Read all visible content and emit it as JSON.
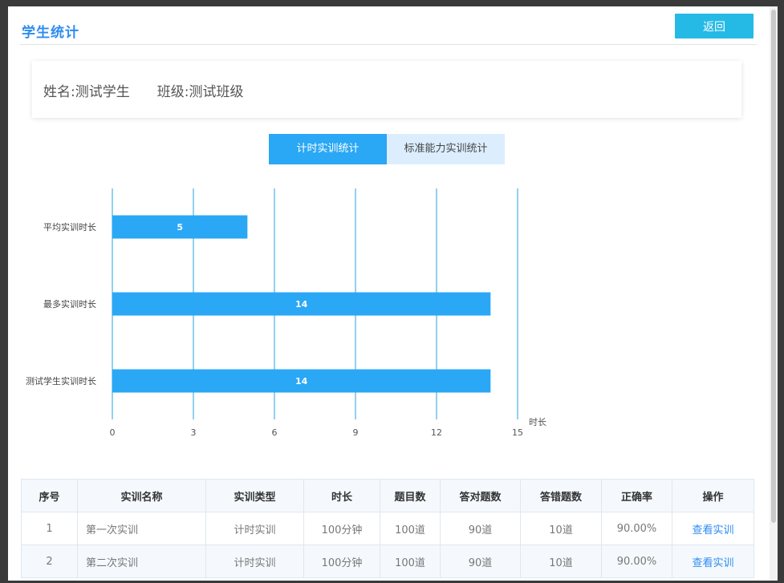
{
  "header": {
    "title": "学生统计",
    "back_label": "返回"
  },
  "info": {
    "name_label": "姓名:",
    "name_value": "测试学生",
    "class_label": "班级:",
    "class_value": "测试班级"
  },
  "tabs": [
    {
      "label": "计时实训统计",
      "active": true
    },
    {
      "label": "标准能力实训统计",
      "active": false
    }
  ],
  "chart_data": {
    "type": "bar",
    "orientation": "horizontal",
    "categories": [
      "平均实训时长",
      "最多实训时长",
      "测试学生实训时长"
    ],
    "values": [
      5,
      14,
      14
    ],
    "xlabel": "时长",
    "xlim": [
      0,
      15
    ],
    "xticks": [
      "0",
      "3",
      "6",
      "9",
      "12",
      "15"
    ],
    "grid": true,
    "bar_color": "#2aa7f5",
    "grid_color": "#25a0e0"
  },
  "table": {
    "headers": [
      "序号",
      "实训名称",
      "实训类型",
      "时长",
      "题目数",
      "答对题数",
      "答错题数",
      "正确率",
      "操作"
    ],
    "rows": [
      [
        "1",
        "第一次实训",
        "计时实训",
        "100分钟",
        "100道",
        "90道",
        "10道",
        "90.00%",
        "查看实训"
      ],
      [
        "2",
        "第二次实训",
        "计时实训",
        "100分钟",
        "100道",
        "90道",
        "10道",
        "90.00%",
        "查看实训"
      ]
    ]
  }
}
